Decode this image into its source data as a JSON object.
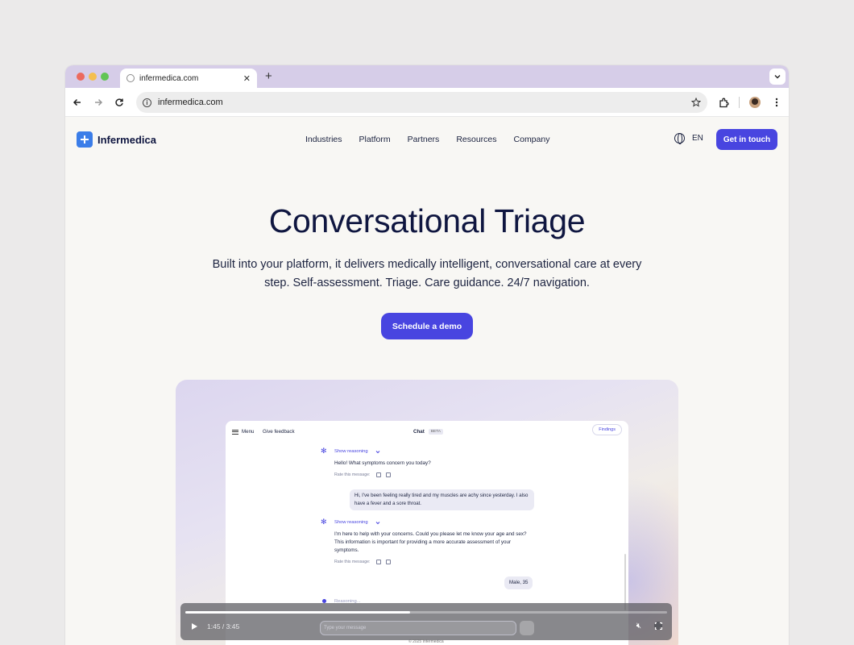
{
  "browser": {
    "tab_title": "infermedica.com",
    "new_tab_label": "+",
    "url": "infermedica.com"
  },
  "site": {
    "brand": "Infermedica",
    "nav": [
      "Industries",
      "Platform",
      "Partners",
      "Resources",
      "Company"
    ],
    "language": "EN",
    "cta_top": "Get in touch"
  },
  "hero": {
    "title": "Conversational Triage",
    "subtitle": "Built into your platform, it delivers medically intelligent, conversational care at every step. Self-assessment. Triage. Care guidance. 24/7 navigation.",
    "cta": "Schedule a demo"
  },
  "app": {
    "menu": "Menu",
    "feedback": "Give feedback",
    "chat_title": "Chat",
    "beta": "BETA",
    "findings": "Findings",
    "show_reasoning": "Show reasoning",
    "msg1": "Hello! What symptoms concern you today?",
    "rate": "Rate this message:",
    "user1": "Hi, I've been feeling really tired and my muscles are achy since yesterday. I also have a fever and a sore throat.",
    "msg2": "I'm here to help with your concerns. Could you please let me know your age and sex? This information is important for providing a more accurate assessment of your symptoms.",
    "user2": "Male, 35",
    "reasoning": "Reasoning...",
    "input_placeholder": "Type your message",
    "footer": "© 2025 Infermedica"
  },
  "video": {
    "time": "1:45 / 3:45",
    "progress": 0.467
  },
  "colors": {
    "accent": "#4845e0",
    "brand": "#3b7de8",
    "tab_strip": "#d6cde8"
  }
}
